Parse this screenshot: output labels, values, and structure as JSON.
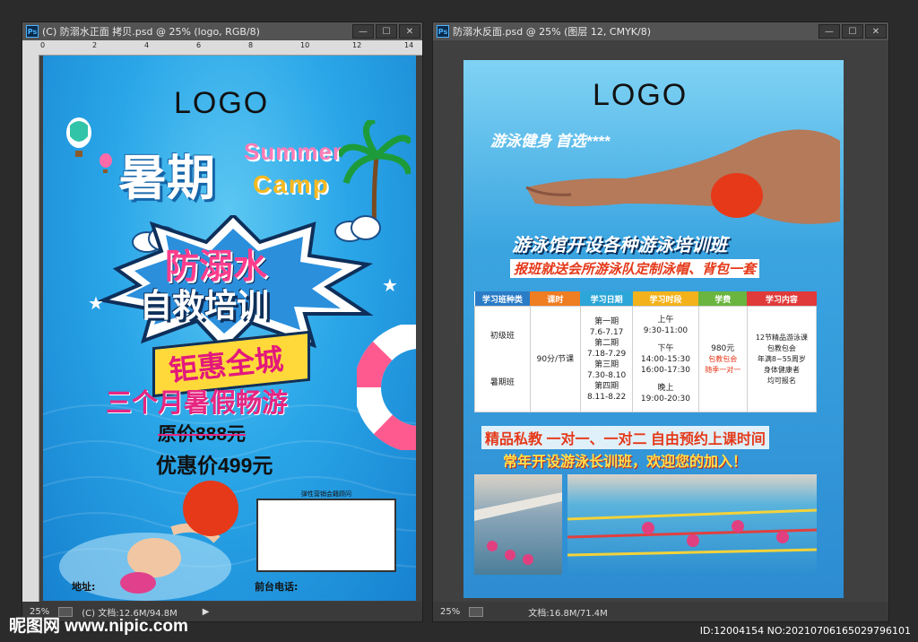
{
  "left_window": {
    "title": "(C) 防溺水正面 拷贝.psd @ 25% (logo, RGB/8)",
    "ruler_ticks": [
      "0",
      "2",
      "4",
      "6",
      "8",
      "10",
      "12",
      "14"
    ],
    "ruler_v_ticks": [
      "0",
      "2",
      "4",
      "6",
      "8",
      "1",
      "1",
      "1",
      "1",
      "1",
      "1",
      "1",
      "1",
      "2",
      "2"
    ],
    "status_zoom": "25%",
    "status_doc": "(C) 文档:12.6M/94.8M",
    "flyer": {
      "logo": "LOGO",
      "title_main": "暑期",
      "title_summer": "Summer",
      "title_camp": "Camp",
      "headline_1": "防溺水",
      "headline_2": "自救培训",
      "badge": "钜惠全城",
      "subhead": "三个月暑假畅游",
      "original_price": "原价888元",
      "discount_price": "优惠价499元",
      "box_caption": "弹性营销会籍顾问",
      "address_label": "地址:",
      "phone_label": "前台电话:"
    }
  },
  "right_window": {
    "title": "防溺水反面.psd @ 25% (图层 12, CMYK/8)",
    "status_zoom": "25%",
    "status_doc": "文档:16.8M/71.4M",
    "flyer": {
      "logo": "LOGO",
      "tagline": "游泳健身  首选****",
      "headline": "游泳馆开设各种游泳培训班",
      "subline": "报班就送会所游泳队定制泳帽、背包一套",
      "table": {
        "headers": [
          "学习班种类",
          "课时",
          "学习日期",
          "学习时段",
          "学费",
          "学习内容"
        ],
        "header_colors": [
          "#2b7cc7",
          "#ef7d22",
          "#2ca6d8",
          "#f3b21b",
          "#69b53f",
          "#e03a3a"
        ],
        "class_types": [
          "初级班",
          "暑期班"
        ],
        "hours": "90分/节课",
        "dates": [
          "第一期",
          "7.6-7.17",
          "第二期",
          "7.18-7.29",
          "第三期",
          "7.30-8.10",
          "第四期",
          "8.11-8.22"
        ],
        "times": [
          "上午",
          "9:30-11:00",
          "下午",
          "14:00-15:30",
          "16:00-17:30",
          "晚上",
          "19:00-20:30"
        ],
        "fee": "980元",
        "fee_note_1": "包教包会",
        "fee_note_2": "随季一对一",
        "content": [
          "12节精品游泳课",
          "包教包会",
          "年满8~55周岁",
          "身体健康者",
          "均可报名"
        ]
      },
      "promo_1": "精品私教  一对一、一对二  自由预约上课时间",
      "promo_2": "常年开设游泳长训班，欢迎您的加入！"
    }
  },
  "footer": {
    "watermark": "昵图网 www.nipic.com",
    "image_id": "ID:12004154 NO:20210706165029796101"
  }
}
